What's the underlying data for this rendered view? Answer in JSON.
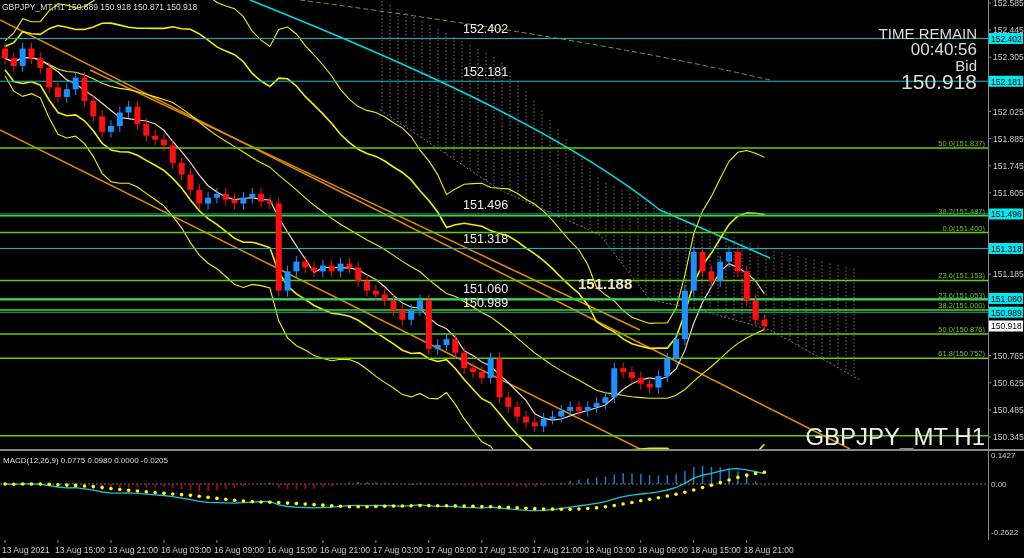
{
  "header": {
    "text": "GBPJPY_MT,H1  150.889 150.918 150.871 150.918"
  },
  "info": {
    "title": "TIME REMAIN",
    "countdown": "00:40:56",
    "price_type": "Bid",
    "price": "150.918"
  },
  "highlight_price": "151.188",
  "symbol_label": "GBPJPY_MT H1",
  "levels": [
    {
      "label": "152.402",
      "tag": "152.402"
    },
    {
      "label": "152.181",
      "tag": "152.181"
    },
    {
      "label": "151.496",
      "tag": "151.496"
    },
    {
      "label": "151.318",
      "tag": "151.318"
    },
    {
      "label": "151.060",
      "tag": "151.060"
    },
    {
      "label": "150.989",
      "tag": "150.989"
    }
  ],
  "fibo_levels": [
    {
      "label": "50.0(151.837)"
    },
    {
      "label": "38.2(151.487)"
    },
    {
      "label": "0.0(151.400)"
    },
    {
      "label": "23.6(151.153)"
    },
    {
      "label": "23.6(151.053)"
    },
    {
      "label": "38.2(151.000)"
    },
    {
      "label": "50.0(150.876)"
    },
    {
      "label": "61.8(150.752)"
    }
  ],
  "current_price_tag": "150.918",
  "price_axis": [
    "152.585",
    "152.445",
    "152.305",
    "152.025",
    "151.885",
    "151.745",
    "151.605",
    "151.185",
    "150.765",
    "150.625",
    "150.485",
    "150.345"
  ],
  "time_axis": [
    "13 Aug 2021",
    "13 Aug 15:00",
    "13 Aug 21:00",
    "16 Aug 03:00",
    "16 Aug 09:00",
    "16 Aug 15:00",
    "16 Aug 21:00",
    "17 Aug 03:00",
    "17 Aug 09:00",
    "17 Aug 15:00",
    "17 Aug 21:00",
    "18 Aug 03:00",
    "18 Aug 09:00",
    "18 Aug 15:00",
    "18 Aug 21:00"
  ],
  "macd": {
    "label": "MACD(12,26,9) 0.0775 0.0980 0.0000 -0.0205",
    "ticks": [
      "0.1427",
      "0.00",
      "-0.2622"
    ]
  }
}
